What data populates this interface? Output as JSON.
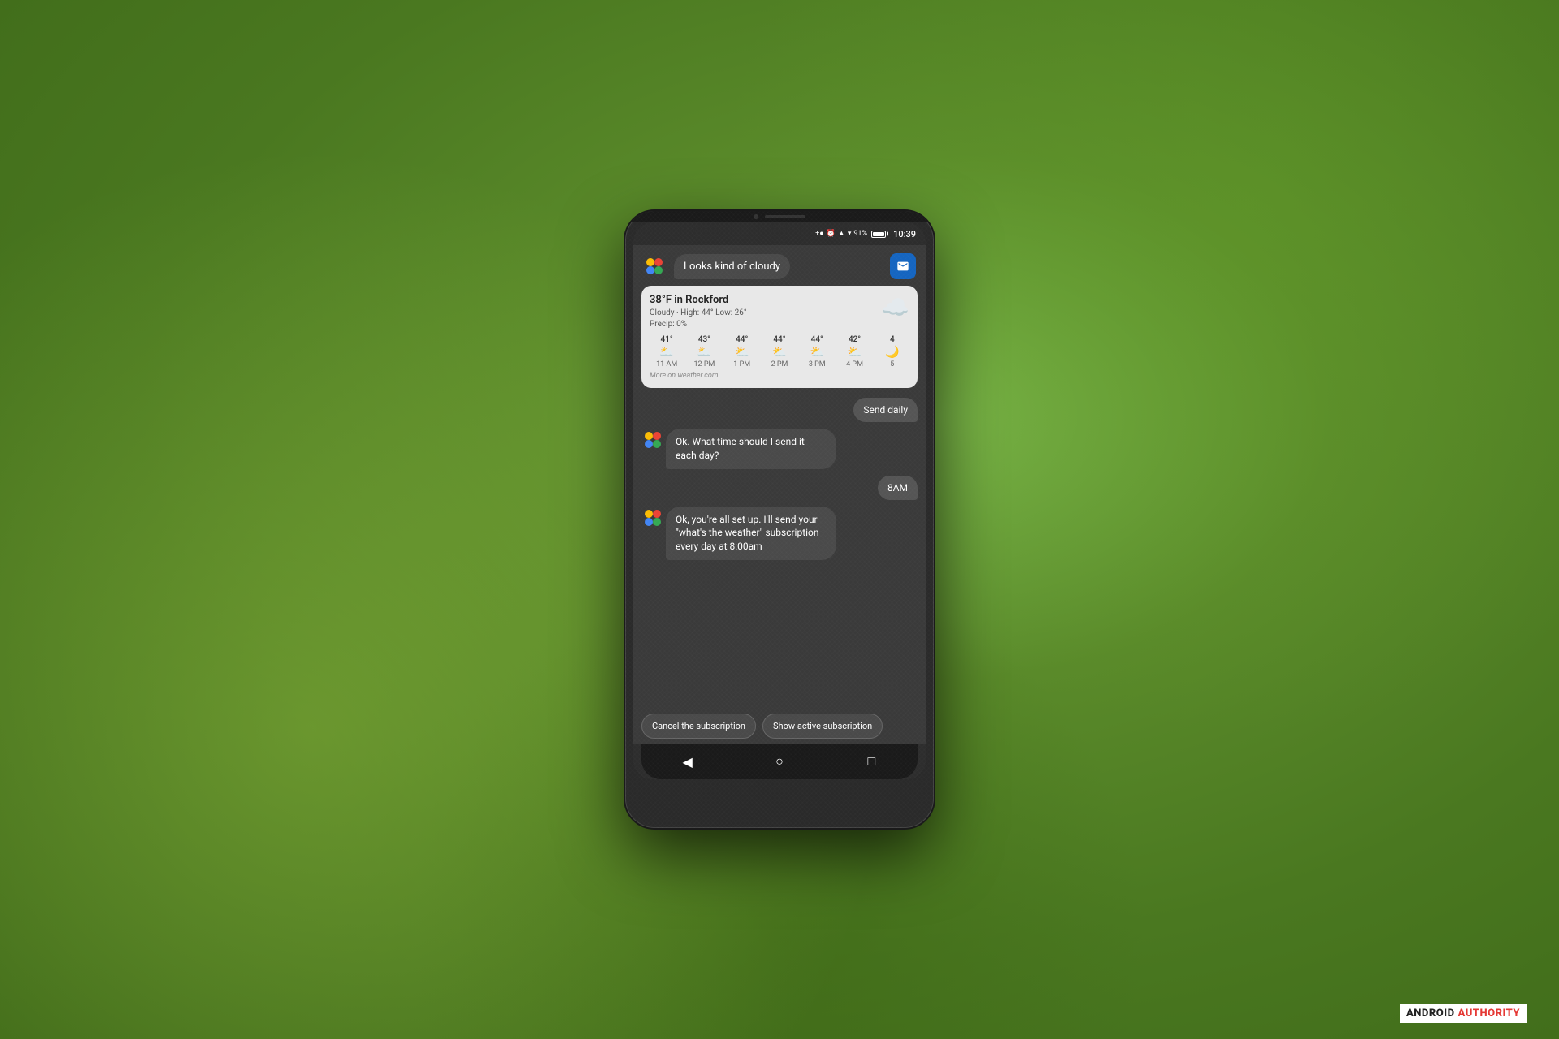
{
  "background": {
    "color": "#5a8a3a"
  },
  "status_bar": {
    "time": "10:39",
    "battery_percent": "91%",
    "icons": [
      "bluetooth",
      "alarm",
      "signal",
      "wifi"
    ]
  },
  "assistant": {
    "greeting_message": "Looks kind of cloudy",
    "question_message": "Ok. What time should I send it each day?",
    "confirmation_message": "Ok, you're all set up. I'll send your \"what's the weather\" subscription every day at 8:00am"
  },
  "weather": {
    "title": "38°F in Rockford",
    "subtitle_line1": "Cloudy · High: 44° Low: 26°",
    "subtitle_line2": "Precip: 0%",
    "source": "More on weather.com",
    "hourly": [
      {
        "temp": "41°",
        "time": "11 AM",
        "icon": "cloudy"
      },
      {
        "temp": "43°",
        "time": "12 PM",
        "icon": "cloudy"
      },
      {
        "temp": "44°",
        "time": "1 PM",
        "icon": "partly-sunny"
      },
      {
        "temp": "44°",
        "time": "2 PM",
        "icon": "partly-sunny"
      },
      {
        "temp": "44°",
        "time": "3 PM",
        "icon": "partly-sunny"
      },
      {
        "temp": "42°",
        "time": "4 PM",
        "icon": "partly-sunny"
      },
      {
        "temp": "4",
        "time": "5",
        "icon": "crescent"
      }
    ]
  },
  "user_replies": {
    "send_daily": "Send daily",
    "eight_am": "8AM"
  },
  "action_buttons": {
    "cancel": "Cancel the subscription",
    "show": "Show active subscription"
  },
  "nav": {
    "back": "◀",
    "home": "○",
    "recents": "□"
  },
  "watermark": {
    "android": "ANDROID",
    "authority": "AUTHORITY"
  }
}
